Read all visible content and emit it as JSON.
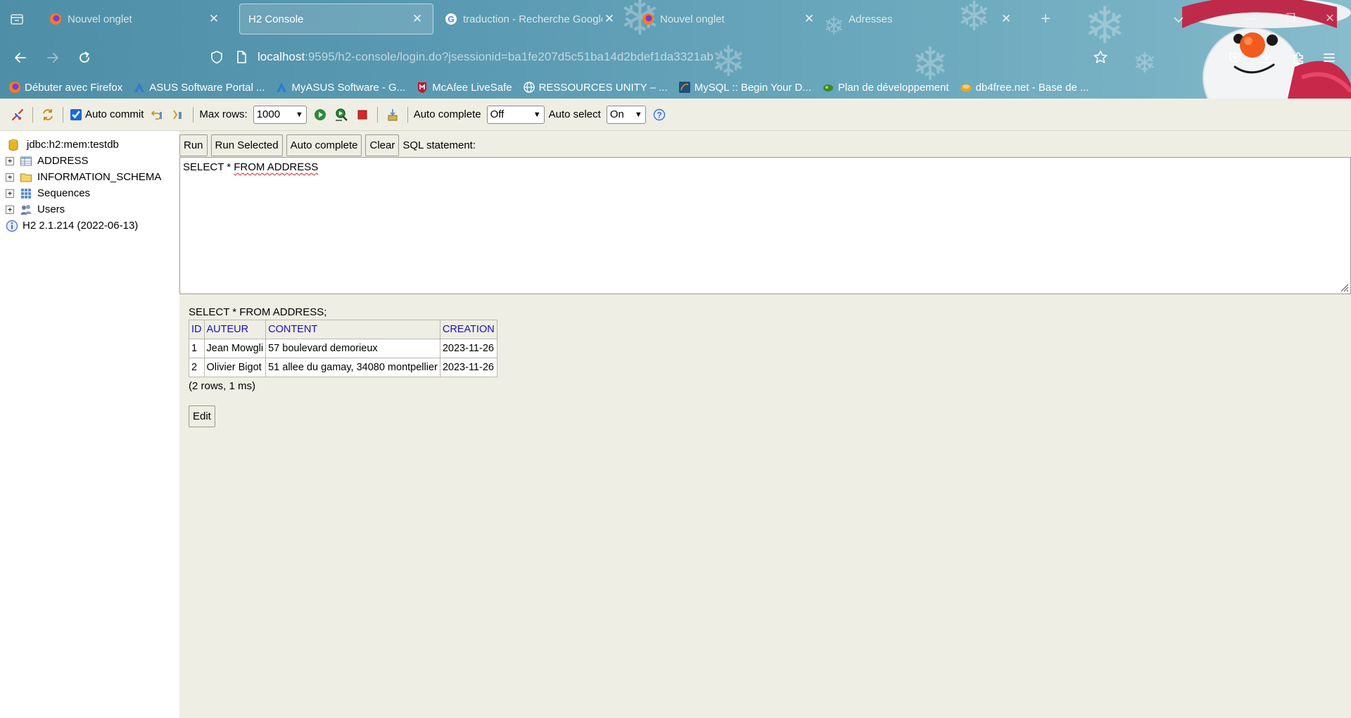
{
  "browser": {
    "tabs": [
      {
        "title": "Nouvel onglet",
        "favicon": "firefox-icon",
        "active": false
      },
      {
        "title": "H2 Console",
        "favicon": "",
        "active": true
      },
      {
        "title": "traduction - Recherche Google",
        "favicon": "google-icon",
        "active": false
      },
      {
        "title": "Nouvel onglet",
        "favicon": "firefox-icon",
        "active": false
      },
      {
        "title": "Adresses",
        "favicon": "",
        "active": false
      }
    ],
    "url_host": "localhost",
    "url_rest": ":9595/h2-console/login.do?jsessionid=ba1fe207d5c51ba14d2bdef1da3321ab",
    "bookmarks": [
      {
        "label": "Débuter avec Firefox",
        "icon": "firefox-icon"
      },
      {
        "label": "ASUS Software Portal ...",
        "icon": "asus-icon"
      },
      {
        "label": "MyASUS Software - G...",
        "icon": "asus-icon"
      },
      {
        "label": "McAfee LiveSafe",
        "icon": "mcafee-icon"
      },
      {
        "label": "RESSOURCES UNITY – ...",
        "icon": "globe-icon"
      },
      {
        "label": "MySQL :: Begin Your D...",
        "icon": "mysql-icon"
      },
      {
        "label": "Plan de développement",
        "icon": "plant-icon"
      },
      {
        "label": "db4free.net - Base de ...",
        "icon": "db4free-icon"
      }
    ]
  },
  "toolbar": {
    "auto_commit_label": "Auto commit",
    "auto_commit_checked": true,
    "max_rows_label": "Max rows:",
    "max_rows_value": "1000",
    "auto_complete_label": "Auto complete",
    "auto_complete_value": "Off",
    "auto_select_label": "Auto select",
    "auto_select_value": "On"
  },
  "tree": {
    "connection": "jdbc:h2:mem:testdb",
    "items": [
      {
        "label": "ADDRESS",
        "icon": "table-icon"
      },
      {
        "label": "INFORMATION_SCHEMA",
        "icon": "folder-icon"
      },
      {
        "label": "Sequences",
        "icon": "sequences-icon"
      },
      {
        "label": "Users",
        "icon": "users-icon"
      }
    ],
    "version": "H2 2.1.214 (2022-06-13)"
  },
  "query": {
    "buttons": {
      "run": "Run",
      "run_selected": "Run Selected",
      "auto_complete": "Auto complete",
      "clear": "Clear"
    },
    "sql_label": "SQL statement:",
    "sql_prefix": "SELECT * ",
    "sql_underlined": "FROM ADDRESS"
  },
  "result": {
    "statement": "SELECT * FROM ADDRESS;",
    "columns": [
      "ID",
      "AUTEUR",
      "CONTENT",
      "CREATION"
    ],
    "rows": [
      [
        "1",
        "Jean Mowgli",
        "57 boulevard demorieux",
        "2023-11-26"
      ],
      [
        "2",
        "Olivier Bigot",
        "51 allee du gamay, 34080 montpellier",
        "2023-11-26"
      ]
    ],
    "info": "(2 rows, 1 ms)",
    "edit_label": "Edit"
  },
  "colors": {
    "chrome_bg": "#5a9ab2",
    "panel_bg": "#efeee4",
    "header_link": "#1a0dcc"
  }
}
